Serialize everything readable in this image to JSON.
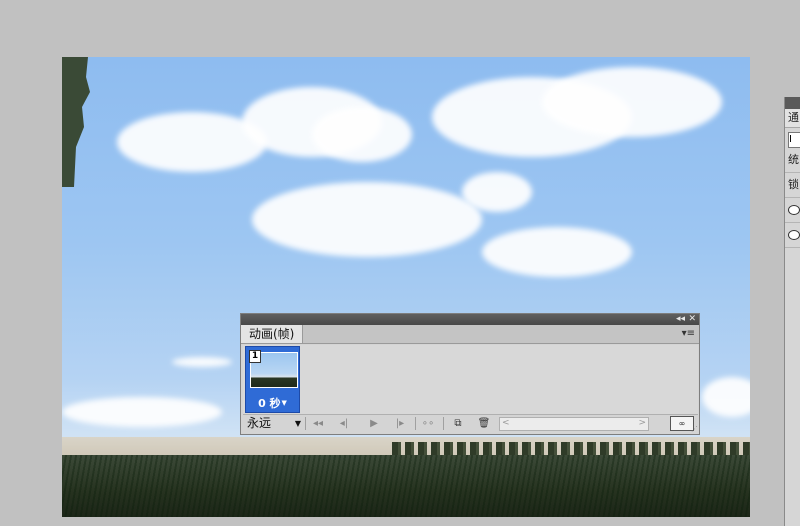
{
  "animation_panel": {
    "tab_label": "动画(帧)",
    "collapse_glyph": "◂◂",
    "close_glyph": "✕",
    "menu_glyph": "▾≡",
    "frames": [
      {
        "number": "1",
        "delay": "0 秒"
      }
    ],
    "loop_option": "永远",
    "tween_glyph": "∞",
    "buttons": {
      "first": "◂◂",
      "prev": "◂|",
      "play": "▶",
      "next": "|▸",
      "tween": "∘∘",
      "new_frame": "⧉",
      "delete": "🗑"
    }
  },
  "right_panel": {
    "tab_label": "通",
    "input_value": "I",
    "row1": "统",
    "row2": "锁"
  }
}
